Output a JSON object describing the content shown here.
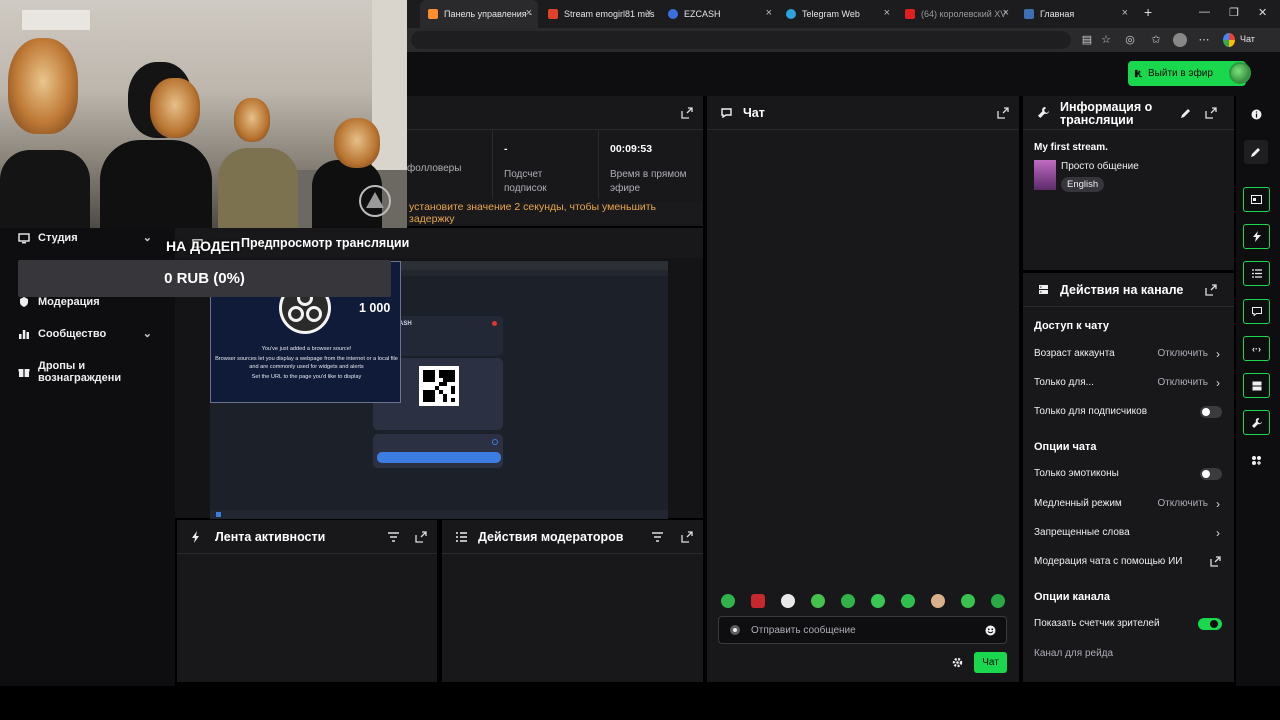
{
  "browser": {
    "tabs": [
      {
        "label": "Панель управления -",
        "active": true,
        "color": "#ff8f2e"
      },
      {
        "label": "Stream emogirl81 mus",
        "active": false,
        "color": "#e0412b"
      },
      {
        "label": "EZCASH",
        "active": false,
        "color": "#3b6fe0"
      },
      {
        "label": "Telegram Web",
        "active": false,
        "color": "#2aa3e0"
      },
      {
        "label": "(64) королевский XV",
        "active": false,
        "color": "#e02020"
      },
      {
        "label": "Главная",
        "active": false,
        "color": "#3d6fb5"
      }
    ],
    "new_tab": "+",
    "profile_label": "Чат"
  },
  "header": {
    "go_live_label": "Выйти в эфир"
  },
  "overlay": {
    "goal_title": "НА ДОДЕП",
    "goal_value": "0 RUB (0%)"
  },
  "left_nav": {
    "items": [
      {
        "label": "Студия",
        "icon": "studio-icon",
        "chevron": true
      },
      {
        "label": "Модерация",
        "icon": "moderation-icon",
        "chevron": false
      },
      {
        "label": "Сообщество",
        "icon": "community-icon",
        "chevron": true
      },
      {
        "label": "Дропы и вознаграждени",
        "icon": "drops-icon",
        "chevron": false
      }
    ]
  },
  "stats": {
    "followers_label": "фолловеры",
    "subs_value": "-",
    "subs_label_1": "Подсчет",
    "subs_label_2": "подписок",
    "live_time_value": "00:09:53",
    "live_time_label_1": "Время в прямом",
    "live_time_label_2": "эфире",
    "warning": "установите значение 2 секунды, чтобы уменьшить задержку"
  },
  "preview": {
    "title": "Предпросмотр трансляции",
    "overlay_number": "1 000",
    "obs_text_1": "You've just added a browser source!",
    "obs_text_2": "Browser sources let you display a webpage from the internet or a local file and are commonly used for widgets and alerts",
    "obs_text_3": "Set the URL to the page you'd like to display",
    "mini_brand": "ASH"
  },
  "activity": {
    "title": "Лента активности"
  },
  "mod_actions": {
    "title": "Действия модераторов"
  },
  "chat": {
    "title": "Чат",
    "input_placeholder": "Отправить сообщение",
    "send_label": "Чат"
  },
  "stream_info": {
    "title_1": "Информация о",
    "title_2": "трансляции",
    "stream_title": "My first stream.",
    "category": "Просто общение",
    "language": "English"
  },
  "channel_actions": {
    "title": "Действия на канале",
    "chat_access_heading": "Доступ к чату",
    "account_age_label": "Возраст аккаунта",
    "account_age_value": "Отключить",
    "only_for_label": "Только для...",
    "only_for_value": "Отключить",
    "subs_only_label": "Только для подписчиков",
    "chat_options_heading": "Опции чата",
    "emotes_only_label": "Только эмотиконы",
    "slow_mode_label": "Медленный режим",
    "slow_mode_value": "Отключить",
    "banned_words_label": "Запрещенные слова",
    "ai_mod_label": "Модерация чата с помощью ИИ",
    "channel_options_heading": "Опции канала",
    "viewer_count_label": "Показать счетчик зрителей",
    "raid_label": "Канал для рейда"
  },
  "colors": {
    "accent": "#19d84e",
    "panel": "#18181b",
    "background": "#0e0e10",
    "warning": "#e8a64a"
  }
}
